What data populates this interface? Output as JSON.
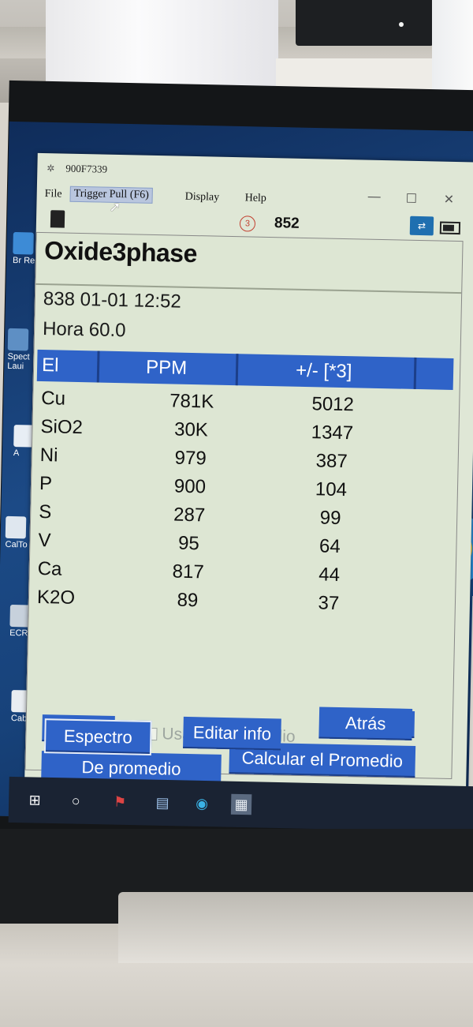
{
  "window": {
    "title": "900F7339"
  },
  "menu": [
    {
      "label": "File"
    },
    {
      "label": "Trigger Pull (F6)"
    },
    {
      "label": "Display"
    },
    {
      "label": "Help"
    }
  ],
  "status": {
    "circled_number": "3",
    "count": "852"
  },
  "result": {
    "method": "Oxide3phase",
    "info_line1": "838  01-01 12:52",
    "info_line2": "Hora 60.0"
  },
  "table": {
    "headers": [
      "El",
      "PPM",
      "+/- [*3]"
    ],
    "rows": [
      {
        "el": "Cu",
        "ppm": "781K",
        "err": "5012"
      },
      {
        "el": "SiO2",
        "ppm": "30K",
        "err": "1347"
      },
      {
        "el": "Ni",
        "ppm": "979",
        "err": "387"
      },
      {
        "el": "P",
        "ppm": "900",
        "err": "104"
      },
      {
        "el": "S",
        "ppm": "287",
        "err": "99"
      },
      {
        "el": "V",
        "ppm": "95",
        "err": "64"
      },
      {
        "el": "Ca",
        "ppm": "817",
        "err": "44"
      },
      {
        "el": "K2O",
        "ppm": "89",
        "err": "37"
      }
    ]
  },
  "controls": {
    "prev_label": "<",
    "next_label": ">",
    "checkbox_label": "Usar en Promedio",
    "de_promedio": "De promedio",
    "calcular": "Calcular el Promedio",
    "espectro": "Espectro",
    "editar": "Editar info",
    "atras": "Atrás"
  },
  "desktop_icons": [
    {
      "label": "Br Rem"
    },
    {
      "label": "Spect Laui"
    },
    {
      "label": "A"
    },
    {
      "label": "CalTo"
    },
    {
      "label": "ECR"
    },
    {
      "label": "Cab"
    }
  ],
  "taskbar": {
    "icons": [
      "windows-start-icon",
      "cortana-circle-icon",
      "app-icon",
      "file-explorer-icon",
      "edge-icon",
      "spectrometer-app-icon"
    ]
  }
}
